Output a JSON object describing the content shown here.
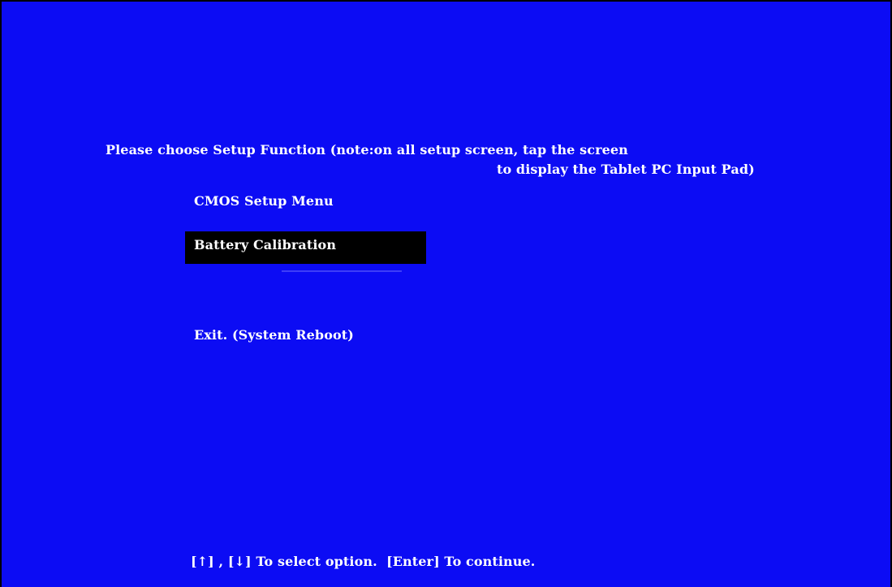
{
  "prompt": {
    "line1": "Please choose Setup Function (note:on all setup screen, tap the screen",
    "line2": "to display the Tablet PC Input Pad)"
  },
  "menu": {
    "items": [
      {
        "label": "CMOS Setup Menu",
        "selected": false
      },
      {
        "label": "Battery Calibration",
        "selected": true
      },
      {
        "label": "Exit. (System Reboot)",
        "selected": false
      }
    ]
  },
  "footer": {
    "hint": "[↑] , [↓] To select option.  [Enter] To continue."
  },
  "colors": {
    "background": "#0c0cf4",
    "text": "#ffffff",
    "selection": "#000000"
  }
}
